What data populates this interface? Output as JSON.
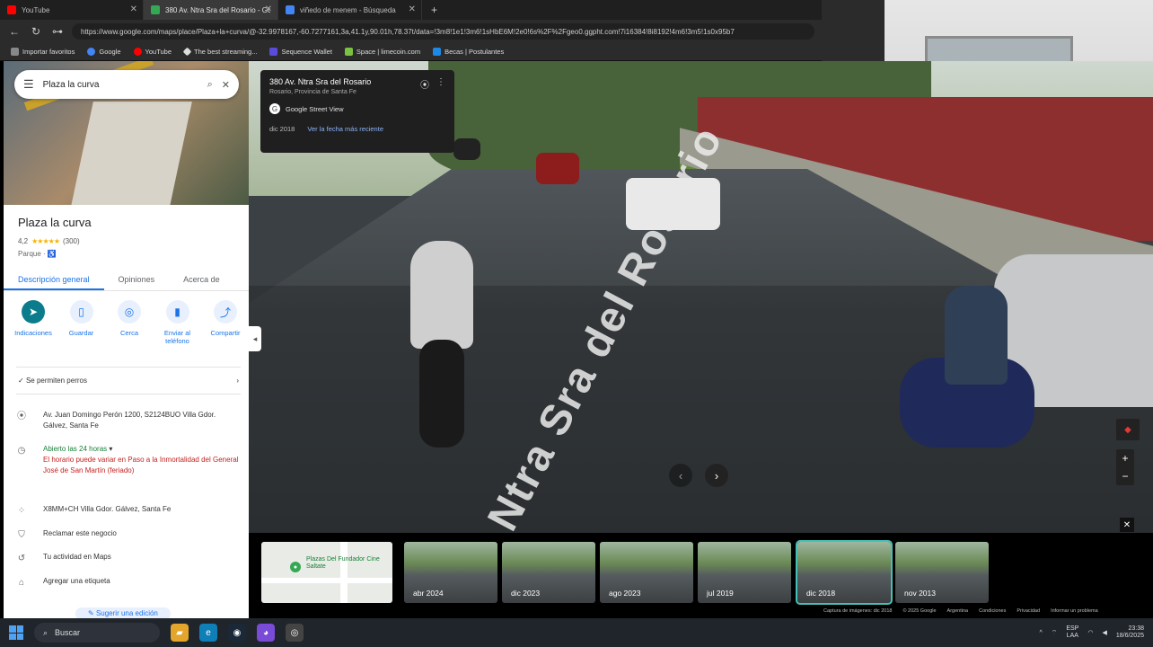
{
  "browser": {
    "tabs": [
      {
        "title": "YouTube",
        "color": "#ff0000"
      },
      {
        "title": "380 Av. Ntra Sra del Rosario - Go",
        "color": "#34a853"
      },
      {
        "title": "viñedo de menem - Búsqueda",
        "color": "#4285f4"
      }
    ],
    "new_tab_label": "+",
    "url": "https://www.google.com/maps/place/Plaza+la+curva/@-32.9978167,-60.7277161,3a,41.1y,90.01h,78.37t/data=!3m8!1e1!3m6!1sHbE6M!2e0!6s%2F%2Fgeo0.ggpht.com!7i16384!8i8192!4m6!3m5!1s0x95b7",
    "bookmarks": [
      {
        "label": "Importar favoritos",
        "color": "#888888"
      },
      {
        "label": "Google",
        "color": "#4285f4"
      },
      {
        "label": "YouTube",
        "color": "#ff0000"
      },
      {
        "label": "The best streaming...",
        "color": "#dddddd"
      },
      {
        "label": "Sequence Wallet",
        "color": "#5b4bdb"
      },
      {
        "label": "Space | limecoin.com",
        "color": "#7cc242"
      },
      {
        "label": "Becas | Postulantes",
        "color": "#1e88e5"
      }
    ]
  },
  "panel": {
    "search_value": "Plaza la curva",
    "place_name": "Plaza la curva",
    "rating": "4,2",
    "stars": "★★★★★",
    "review_count": "(300)",
    "place_type": "Parque · ♿",
    "tabs": [
      "Descripción general",
      "Opiniones",
      "Acerca de"
    ],
    "actions": [
      {
        "label": "Indicaciones",
        "glyph": "➤"
      },
      {
        "label": "Guardar",
        "glyph": "▯"
      },
      {
        "label": "Cerca",
        "glyph": "◎"
      },
      {
        "label": "Enviar al teléfono",
        "glyph": "▮"
      },
      {
        "label": "Compartir",
        "glyph": "⤴"
      }
    ],
    "pets_text": "Se permiten perros",
    "address": "Av. Juan Domingo Perón 1200, S2124BUO Villa Gdor. Gálvez, Santa Fe",
    "hours": "Abierto las 24 horas",
    "hours_note": "El horario puede variar en Paso a la Inmortalidad del General José de San Martín (feriado)",
    "plus_code": "X8MM+CH Villa Gdor. Gálvez, Santa Fe",
    "claim": "Reclamar este negocio",
    "activity": "Tu actividad en Maps",
    "add_label": "Agregar una etiqueta",
    "suggest": "Sugerir una edición"
  },
  "streetview": {
    "address": "380 Av. Ntra Sra del Rosario",
    "locality": "Rosario, Provincia de Santa Fe",
    "source": "Google Street View",
    "date": "dic 2018",
    "latest_link": "Ver la fecha más reciente",
    "road_text": "Av. Ntra Sra del Rosario"
  },
  "timeline": {
    "map_label": "Plazas Del Fundador Cine Saltate",
    "thumbs": [
      "abr 2024",
      "dic 2023",
      "ago 2023",
      "jul 2019",
      "dic 2018",
      "nov 2013"
    ],
    "selected_index": 4,
    "footer": [
      "Captura de imágenes: dic 2018",
      "© 2025 Google",
      "Argentina",
      "Condiciones",
      "Privacidad",
      "Informar un problema"
    ]
  },
  "taskbar": {
    "search_placeholder": "Buscar",
    "lang_top": "ESP",
    "lang_bottom": "LAA",
    "time": "23:38",
    "date": "18/6/2025"
  }
}
